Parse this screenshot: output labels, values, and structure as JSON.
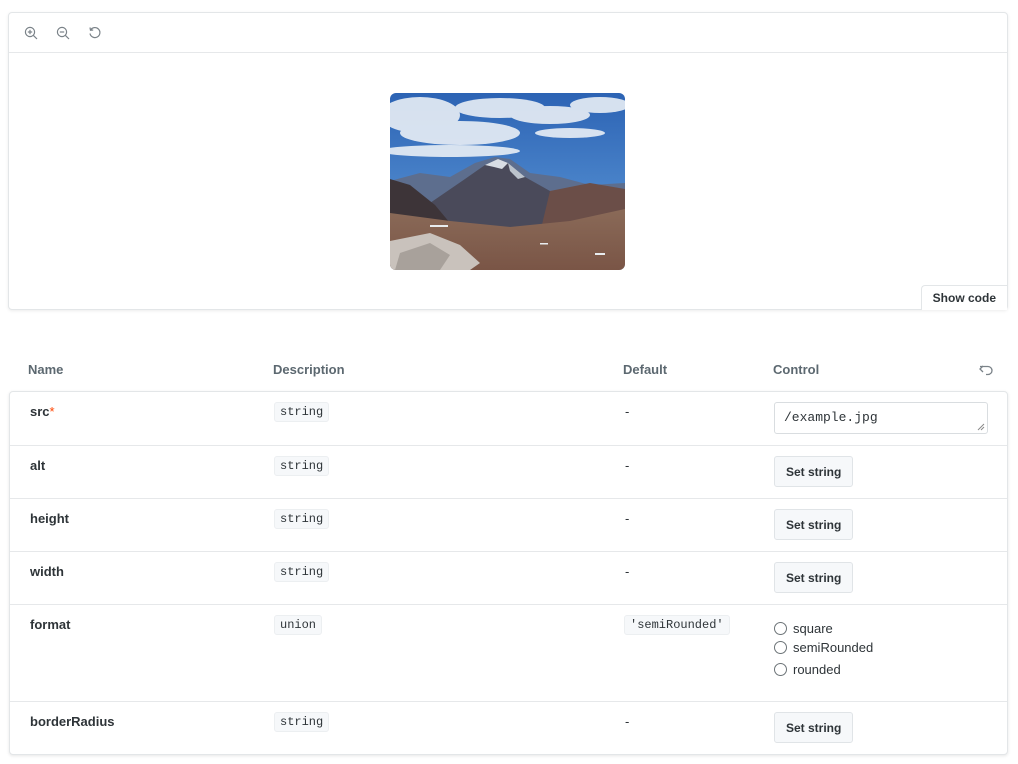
{
  "toolbar": {
    "zoom_in_icon": "zoom-in-icon",
    "zoom_out_icon": "zoom-out-icon",
    "reset_icon": "reset-zoom-icon"
  },
  "preview": {
    "show_code_label": "Show code"
  },
  "table": {
    "headers": {
      "name": "Name",
      "description": "Description",
      "default": "Default",
      "control": "Control"
    },
    "rows": [
      {
        "name": "src",
        "required_mark": "*",
        "type": "string",
        "default": "-",
        "control_value": "/example.jpg"
      },
      {
        "name": "alt",
        "type": "string",
        "default": "-",
        "control_label": "Set string"
      },
      {
        "name": "height",
        "type": "string",
        "default": "-",
        "control_label": "Set string"
      },
      {
        "name": "width",
        "type": "string",
        "default": "-",
        "control_label": "Set string"
      },
      {
        "name": "format",
        "type": "union",
        "default": "'semiRounded'",
        "options": [
          "square",
          "semiRounded",
          "rounded"
        ]
      },
      {
        "name": "borderRadius",
        "type": "string",
        "default": "-",
        "control_label": "Set string"
      }
    ]
  },
  "colors": {
    "required": "#ff4400",
    "border": "#e3e6e8",
    "chip_bg": "#f6f8fa"
  }
}
